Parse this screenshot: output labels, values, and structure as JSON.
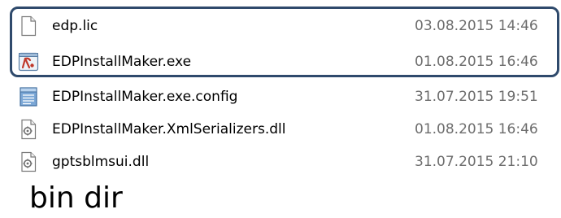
{
  "files": [
    {
      "name": "edp.lic",
      "date": "03.08.2015 14:46",
      "icon": "blank-file-icon"
    },
    {
      "name": "EDPInstallMaker.exe",
      "date": "01.08.2015 16:46",
      "icon": "exe-app-icon"
    },
    {
      "name": "EDPInstallMaker.exe.config",
      "date": "31.07.2015 19:51",
      "icon": "config-file-icon"
    },
    {
      "name": "EDPInstallMaker.XmlSerializers.dll",
      "date": "01.08.2015 16:46",
      "icon": "dll-file-icon"
    },
    {
      "name": "gptsblmsui.dll",
      "date": "31.07.2015 21:10",
      "icon": "dll-file-icon"
    }
  ],
  "caption": "bin dir",
  "colors": {
    "highlight_border": "#2f4a6c",
    "date_text": "#6d6d6d",
    "name_text": "#000000"
  }
}
